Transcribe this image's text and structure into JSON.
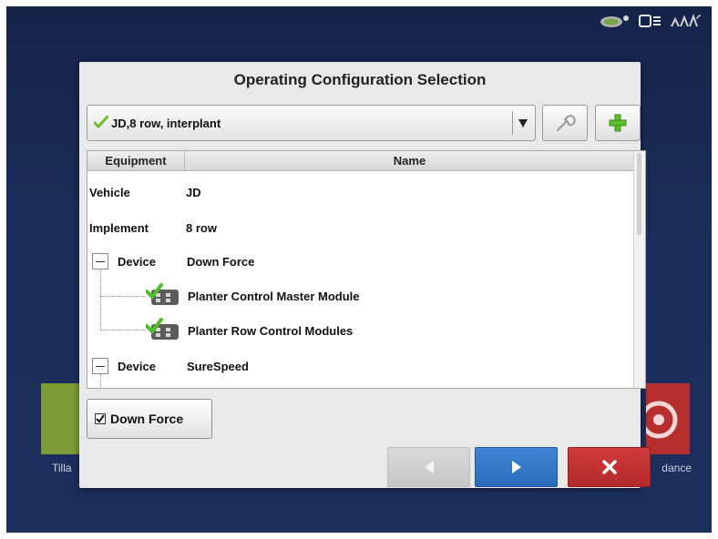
{
  "dialog": {
    "title": "Operating Configuration Selection",
    "selected_configuration": "JD,8 row, interplant",
    "columns": [
      "Equipment",
      "Name"
    ],
    "rows": [
      {
        "equipment": "Vehicle",
        "name": "JD"
      },
      {
        "equipment": "Implement",
        "name": "8 row"
      },
      {
        "equipment": "Device",
        "name": "Down Force"
      },
      {
        "equipment": "",
        "name": "Planter Control Master Module"
      },
      {
        "equipment": "",
        "name": "Planter Row Control Modules"
      },
      {
        "equipment": "Device",
        "name": "SureSpeed"
      }
    ],
    "checkbox_label": "Down Force",
    "checkbox_checked": true
  },
  "background": {
    "left_tile_label": "Tilla",
    "right_tile_label": "dance"
  },
  "icons": {
    "config_status": "check-icon",
    "edit": "wrench-icon",
    "add": "plus-icon",
    "back": "left-arrow-icon",
    "next": "right-arrow-icon",
    "cancel": "close-icon"
  },
  "colors": {
    "next_button": "#2f74c4",
    "cancel_button": "#c03232",
    "add_icon": "#5cbf2a",
    "check": "#6cc02e"
  }
}
